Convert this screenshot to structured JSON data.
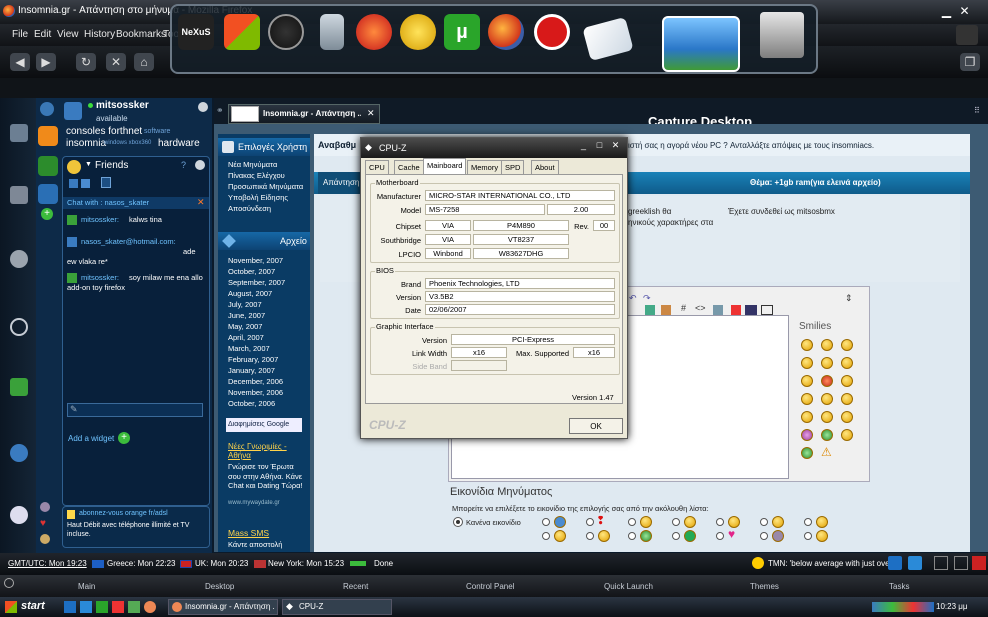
{
  "window": {
    "title": "Insomnia.gr - Απάντηση στο μήνυμα - Mozilla Firefox"
  },
  "menu": [
    "File",
    "Edit",
    "View",
    "History",
    "Bookmarks",
    "Tools"
  ],
  "dock": {
    "icons": [
      "nexus-logo-icon",
      "windows-logo-icon",
      "clock-icon",
      "recycle-bin-icon",
      "ccleaner-icon",
      "daemon-tools-icon",
      "utorrent-icon",
      "firefox-icon",
      "no-entry-icon",
      "mail-icon",
      "camera-icon",
      "system-monitor-icon"
    ],
    "nexus_label": "NeXuS",
    "utorrent_label": "µ"
  },
  "messenger": {
    "username": "mitsossker",
    "status": "available",
    "personal_message": "consoles forthnet",
    "pm_tag1": "software",
    "pm_line2": "insomnia",
    "pm_tag2": "windows xbox360",
    "pm_tag3": "hardware",
    "friends_title": "Friends",
    "friends_count": "?",
    "chat_with": "Chat with : nasos_skater",
    "messages": [
      {
        "from": "mitsossker:",
        "text": "kalws tina"
      },
      {
        "from": "nasos_skater@hotmail.com:",
        "text": "ade ew vlaka re*"
      },
      {
        "from": "mitsossker:",
        "text": "soy milaw me ena allo add-on toy firefox"
      }
    ],
    "add_widget": "Add a widget",
    "ad_title": "abonnez-vous orange fr/adsl",
    "ad_text": "Haut Débit avec téléphone illimité et TV incluse."
  },
  "browser": {
    "tab_title": "Insomnia.gr - Απάντηση ...",
    "capture_desktop": "Capture Desktop",
    "topbar_left": "Αναβαθμ",
    "topbar_text": "ιστή σας η αγορά νέου PC ? Ανταλλάξτε απόψεις με τους insomniacs.",
    "reply_tab": "Απάντηση",
    "subject_label": "Θέμα: +1gb ram(για ελεινά αρχείο)",
    "greeklish_hint1": "greeklish θα",
    "greeklish_hint2": "ηνικούς χαρακτήρες στα",
    "logged_in": "Έχετε συνδεθεί ως mitsosbmx",
    "user_options": "Επιλογές Χρήστη",
    "nav_links": [
      "Νέα Μηνύματα",
      "Πίνακας Ελέγχου",
      "Προσωπικά Μηνύματα",
      "Υποβολή Είδησης",
      "Αποσύνδεση"
    ],
    "archive_title": "Αρχείο",
    "archive": [
      "November, 2007",
      "October, 2007",
      "September, 2007",
      "August, 2007",
      "July, 2007",
      "June, 2007",
      "May, 2007",
      "April, 2007",
      "March, 2007",
      "February, 2007",
      "January, 2007",
      "December, 2006",
      "November, 2006",
      "October, 2006"
    ],
    "google_label": "Διαφημίσεις Google",
    "ad1_title": "Νέες Γνωριμίες - Αθήνα",
    "ad1_text": "Γνώρισε τον Έρωτα σου στην Αθήνα. Κάνε Chat και Dating Τώρα!",
    "ad1_url": "www.mywaydate.gr",
    "ad2_title": "Mass SMS",
    "ad2_text": "Κάντε αποστολή",
    "smilies_title": "Smilies",
    "icons_title": "Εικονίδια Μηνύματος",
    "icons_desc": "Μπορείτε να επιλέξετε το εικονίδιο της επιλογής σας από την ακόλουθη λίστα:",
    "no_icon": "Κανένα εικονίδιο"
  },
  "cpuz": {
    "title": "CPU-Z",
    "tabs": [
      "CPU",
      "Cache",
      "Mainboard",
      "Memory",
      "SPD",
      "About"
    ],
    "selected_tab": "Mainboard",
    "motherboard_group": "Motherboard",
    "manufacturer_label": "Manufacturer",
    "manufacturer": "MICRO-STAR INTERNATIONAL CO., LTD",
    "model_label": "Model",
    "model": "MS-7258",
    "model_rev": "2.00",
    "chipset_label": "Chipset",
    "chipset_vendor": "VIA",
    "chipset": "P4M890",
    "rev_label": "Rev.",
    "chipset_rev": "00",
    "southbridge_label": "Southbridge",
    "sb_vendor": "VIA",
    "southbridge": "VT8237",
    "lpcio_label": "LPCIO",
    "lpcio_vendor": "Winbond",
    "lpcio": "W83627DHG",
    "bios_group": "BIOS",
    "brand_label": "Brand",
    "bios_brand": "Phoenix Technologies, LTD",
    "version_label": "Version",
    "bios_version": "V3.5B2",
    "date_label": "Date",
    "bios_date": "02/06/2007",
    "graphic_group": "Graphic Interface",
    "gi_version_label": "Version",
    "gi_version": "PCI-Express",
    "link_width_label": "Link Width",
    "link_width": "x16",
    "max_supported_label": "Max. Supported",
    "max_supported": "x16",
    "side_band_label": "Side Band",
    "version_text": "Version 1.47",
    "logo": "CPU-Z",
    "ok": "OK"
  },
  "status": {
    "clocks": [
      "GMT/UTC: Mon 19:23",
      "Greece: Mon 22:23",
      "UK: Mon 20:23",
      "New York: Mon 15:23"
    ],
    "done": "Done",
    "tmn": "TMN: 'below average with just over'"
  },
  "dockbar": [
    "Main",
    "Desktop",
    "Recent",
    "Control Panel",
    "Quick Launch",
    "Themes",
    "Tasks"
  ],
  "taskbar": {
    "start": "start",
    "items": [
      "Insomnia.gr - Απάντηση ...",
      "CPU-Z"
    ],
    "time": "10:23 μμ"
  },
  "colors": {
    "accent": "#1a82b8",
    "sidebar": "#0d2a48",
    "utorrent": "#2aa52a"
  }
}
